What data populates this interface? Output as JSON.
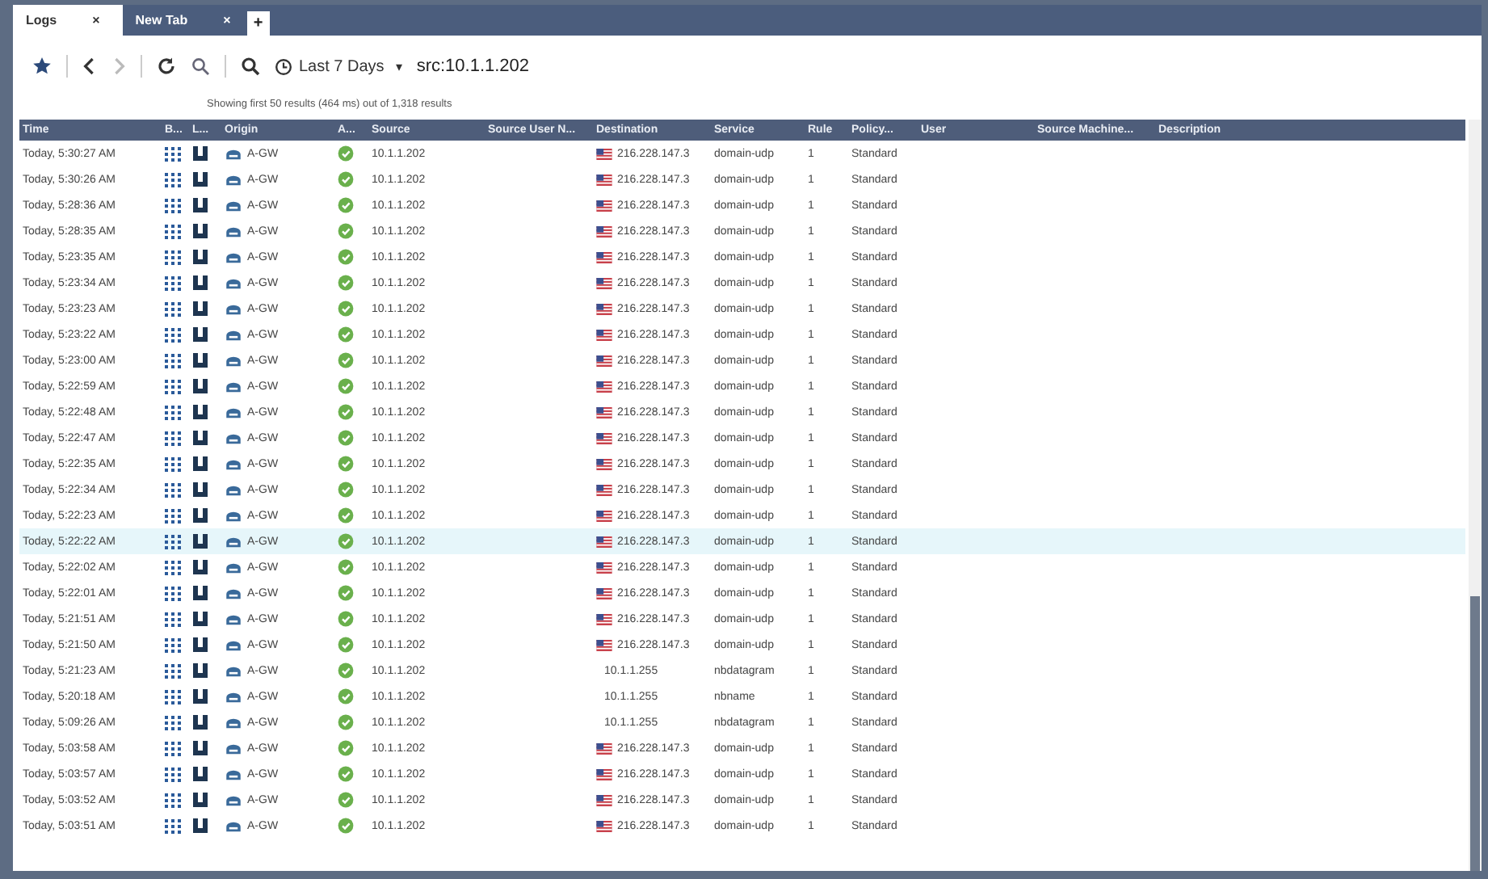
{
  "tabs": [
    {
      "label": "Logs",
      "close": "×",
      "selected": true
    },
    {
      "label": "New Tab",
      "close": "×",
      "selected": false
    }
  ],
  "new_tab": "+",
  "toolbar": {
    "time_range": "Last 7 Days",
    "caret": "▾",
    "query": "src:10.1.1.202",
    "forward_disabled": true
  },
  "results_summary": "Showing first 50 results (464 ms) out of 1,318 results",
  "table": {
    "columns": [
      "Time",
      "B...",
      "L...",
      "Origin",
      "A...",
      "Source",
      "Source User N...",
      "Destination",
      "Service",
      "Rule",
      "Policy...",
      "User",
      "Source Machine...",
      "Description"
    ],
    "rows": [
      {
        "time": "Today, 5:30:27 AM",
        "origin": "A-GW",
        "source": "10.1.1.202",
        "destination": "216.228.147.3",
        "flag": true,
        "service": "domain-udp",
        "rule": "1",
        "policy": "Standard",
        "selected": false
      },
      {
        "time": "Today, 5:30:26 AM",
        "origin": "A-GW",
        "source": "10.1.1.202",
        "destination": "216.228.147.3",
        "flag": true,
        "service": "domain-udp",
        "rule": "1",
        "policy": "Standard",
        "selected": false
      },
      {
        "time": "Today, 5:28:36 AM",
        "origin": "A-GW",
        "source": "10.1.1.202",
        "destination": "216.228.147.3",
        "flag": true,
        "service": "domain-udp",
        "rule": "1",
        "policy": "Standard",
        "selected": false
      },
      {
        "time": "Today, 5:28:35 AM",
        "origin": "A-GW",
        "source": "10.1.1.202",
        "destination": "216.228.147.3",
        "flag": true,
        "service": "domain-udp",
        "rule": "1",
        "policy": "Standard",
        "selected": false
      },
      {
        "time": "Today, 5:23:35 AM",
        "origin": "A-GW",
        "source": "10.1.1.202",
        "destination": "216.228.147.3",
        "flag": true,
        "service": "domain-udp",
        "rule": "1",
        "policy": "Standard",
        "selected": false
      },
      {
        "time": "Today, 5:23:34 AM",
        "origin": "A-GW",
        "source": "10.1.1.202",
        "destination": "216.228.147.3",
        "flag": true,
        "service": "domain-udp",
        "rule": "1",
        "policy": "Standard",
        "selected": false
      },
      {
        "time": "Today, 5:23:23 AM",
        "origin": "A-GW",
        "source": "10.1.1.202",
        "destination": "216.228.147.3",
        "flag": true,
        "service": "domain-udp",
        "rule": "1",
        "policy": "Standard",
        "selected": false
      },
      {
        "time": "Today, 5:23:22 AM",
        "origin": "A-GW",
        "source": "10.1.1.202",
        "destination": "216.228.147.3",
        "flag": true,
        "service": "domain-udp",
        "rule": "1",
        "policy": "Standard",
        "selected": false
      },
      {
        "time": "Today, 5:23:00 AM",
        "origin": "A-GW",
        "source": "10.1.1.202",
        "destination": "216.228.147.3",
        "flag": true,
        "service": "domain-udp",
        "rule": "1",
        "policy": "Standard",
        "selected": false
      },
      {
        "time": "Today, 5:22:59 AM",
        "origin": "A-GW",
        "source": "10.1.1.202",
        "destination": "216.228.147.3",
        "flag": true,
        "service": "domain-udp",
        "rule": "1",
        "policy": "Standard",
        "selected": false
      },
      {
        "time": "Today, 5:22:48 AM",
        "origin": "A-GW",
        "source": "10.1.1.202",
        "destination": "216.228.147.3",
        "flag": true,
        "service": "domain-udp",
        "rule": "1",
        "policy": "Standard",
        "selected": false
      },
      {
        "time": "Today, 5:22:47 AM",
        "origin": "A-GW",
        "source": "10.1.1.202",
        "destination": "216.228.147.3",
        "flag": true,
        "service": "domain-udp",
        "rule": "1",
        "policy": "Standard",
        "selected": false
      },
      {
        "time": "Today, 5:22:35 AM",
        "origin": "A-GW",
        "source": "10.1.1.202",
        "destination": "216.228.147.3",
        "flag": true,
        "service": "domain-udp",
        "rule": "1",
        "policy": "Standard",
        "selected": false
      },
      {
        "time": "Today, 5:22:34 AM",
        "origin": "A-GW",
        "source": "10.1.1.202",
        "destination": "216.228.147.3",
        "flag": true,
        "service": "domain-udp",
        "rule": "1",
        "policy": "Standard",
        "selected": false
      },
      {
        "time": "Today, 5:22:23 AM",
        "origin": "A-GW",
        "source": "10.1.1.202",
        "destination": "216.228.147.3",
        "flag": true,
        "service": "domain-udp",
        "rule": "1",
        "policy": "Standard",
        "selected": false
      },
      {
        "time": "Today, 5:22:22 AM",
        "origin": "A-GW",
        "source": "10.1.1.202",
        "destination": "216.228.147.3",
        "flag": true,
        "service": "domain-udp",
        "rule": "1",
        "policy": "Standard",
        "selected": true
      },
      {
        "time": "Today, 5:22:02 AM",
        "origin": "A-GW",
        "source": "10.1.1.202",
        "destination": "216.228.147.3",
        "flag": true,
        "service": "domain-udp",
        "rule": "1",
        "policy": "Standard",
        "selected": false
      },
      {
        "time": "Today, 5:22:01 AM",
        "origin": "A-GW",
        "source": "10.1.1.202",
        "destination": "216.228.147.3",
        "flag": true,
        "service": "domain-udp",
        "rule": "1",
        "policy": "Standard",
        "selected": false
      },
      {
        "time": "Today, 5:21:51 AM",
        "origin": "A-GW",
        "source": "10.1.1.202",
        "destination": "216.228.147.3",
        "flag": true,
        "service": "domain-udp",
        "rule": "1",
        "policy": "Standard",
        "selected": false
      },
      {
        "time": "Today, 5:21:50 AM",
        "origin": "A-GW",
        "source": "10.1.1.202",
        "destination": "216.228.147.3",
        "flag": true,
        "service": "domain-udp",
        "rule": "1",
        "policy": "Standard",
        "selected": false
      },
      {
        "time": "Today, 5:21:23 AM",
        "origin": "A-GW",
        "source": "10.1.1.202",
        "destination": "10.1.1.255",
        "flag": false,
        "service": "nbdatagram",
        "rule": "1",
        "policy": "Standard",
        "selected": false
      },
      {
        "time": "Today, 5:20:18 AM",
        "origin": "A-GW",
        "source": "10.1.1.202",
        "destination": "10.1.1.255",
        "flag": false,
        "service": "nbname",
        "rule": "1",
        "policy": "Standard",
        "selected": false
      },
      {
        "time": "Today, 5:09:26 AM",
        "origin": "A-GW",
        "source": "10.1.1.202",
        "destination": "10.1.1.255",
        "flag": false,
        "service": "nbdatagram",
        "rule": "1",
        "policy": "Standard",
        "selected": false
      },
      {
        "time": "Today, 5:03:58 AM",
        "origin": "A-GW",
        "source": "10.1.1.202",
        "destination": "216.228.147.3",
        "flag": true,
        "service": "domain-udp",
        "rule": "1",
        "policy": "Standard",
        "selected": false
      },
      {
        "time": "Today, 5:03:57 AM",
        "origin": "A-GW",
        "source": "10.1.1.202",
        "destination": "216.228.147.3",
        "flag": true,
        "service": "domain-udp",
        "rule": "1",
        "policy": "Standard",
        "selected": false
      },
      {
        "time": "Today, 5:03:52 AM",
        "origin": "A-GW",
        "source": "10.1.1.202",
        "destination": "216.228.147.3",
        "flag": true,
        "service": "domain-udp",
        "rule": "1",
        "policy": "Standard",
        "selected": false
      },
      {
        "time": "Today, 5:03:51 AM",
        "origin": "A-GW",
        "source": "10.1.1.202",
        "destination": "216.228.147.3",
        "flag": true,
        "service": "domain-udp",
        "rule": "1",
        "policy": "Standard",
        "selected": false
      }
    ]
  }
}
